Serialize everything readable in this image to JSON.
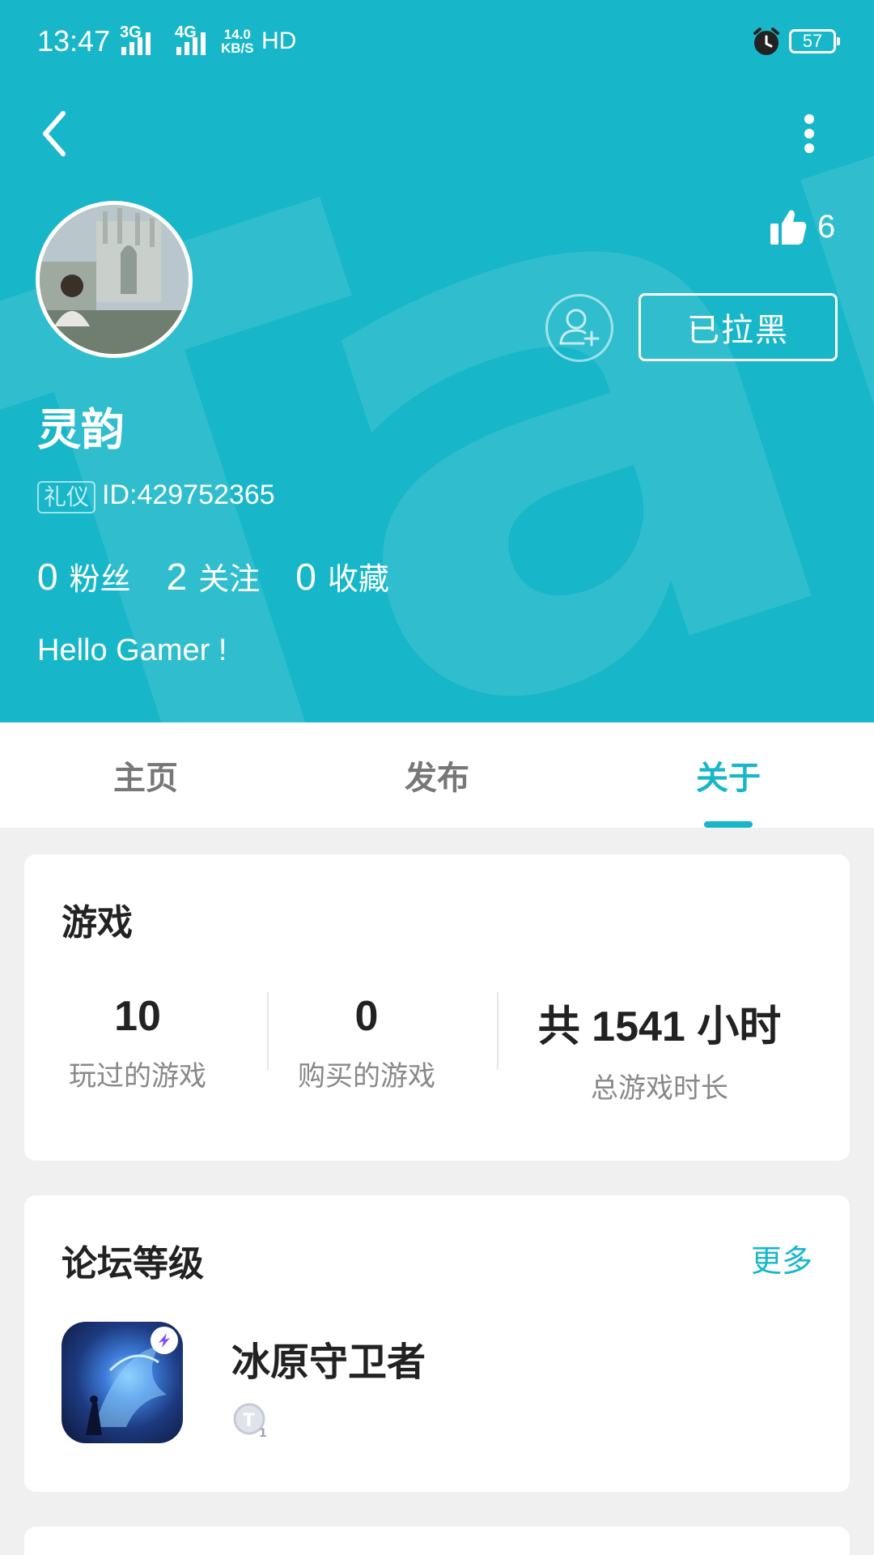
{
  "status_bar": {
    "time": "13:47",
    "signal1": "3G",
    "signal2": "4G",
    "speed_value": "14.0",
    "speed_unit": "KB/S",
    "hd": "HD",
    "battery": "57"
  },
  "profile": {
    "likes": "6",
    "blocked_label": "已拉黑",
    "name": "灵韵",
    "etiquette_label": "礼仪",
    "id_text": "ID:429752365",
    "stats": [
      {
        "value": "0",
        "label": "粉丝"
      },
      {
        "value": "2",
        "label": "关注"
      },
      {
        "value": "0",
        "label": "收藏"
      }
    ],
    "bio": "Hello Gamer !"
  },
  "tabs": [
    {
      "label": "主页"
    },
    {
      "label": "发布"
    },
    {
      "label": "关于"
    }
  ],
  "active_tab": "关于",
  "games_card": {
    "title": "游戏",
    "stats": [
      {
        "value": "10",
        "label": "玩过的游戏"
      },
      {
        "value": "0",
        "label": "购买的游戏"
      },
      {
        "value": "共 1541 小时",
        "label": "总游戏时长"
      }
    ]
  },
  "forum_card": {
    "title": "论坛等级",
    "more": "更多",
    "items": [
      {
        "name": "冰原守卫者",
        "level": "T1"
      }
    ]
  },
  "colors": {
    "accent": "#17b7c9",
    "background": "#f0f0f0"
  }
}
